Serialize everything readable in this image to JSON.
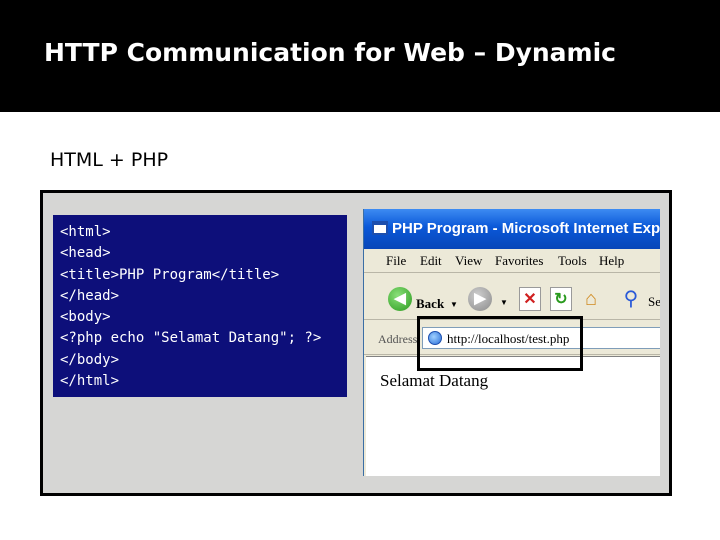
{
  "slide": {
    "title": "HTTP Communication for Web – Dynamic",
    "subtitle": "HTML + PHP"
  },
  "code": {
    "lines": [
      "<html>",
      "<head>",
      "<title>PHP Program</title>",
      "</head>",
      "<body>",
      "<?php echo \"Selamat Datang\"; ?>",
      "</body>",
      "</html>"
    ]
  },
  "browser": {
    "window_title": "PHP Program - Microsoft Internet Explorer",
    "menu": [
      "File",
      "Edit",
      "View",
      "Favorites",
      "Tools",
      "Help"
    ],
    "toolbar": {
      "back_label": "Back",
      "search_label": "Se"
    },
    "address": {
      "label": "Address",
      "value": "http://localhost/test.php"
    },
    "page_content": "Selamat Datang"
  },
  "colors": {
    "code_background": "#0d0f7a",
    "title_bar": "#000000",
    "ie_titlebar": "#0a58d8"
  },
  "icons": [
    "ie-app-icon",
    "back-arrow-icon",
    "forward-arrow-icon",
    "stop-icon",
    "refresh-icon",
    "home-icon",
    "search-icon",
    "page-icon"
  ]
}
